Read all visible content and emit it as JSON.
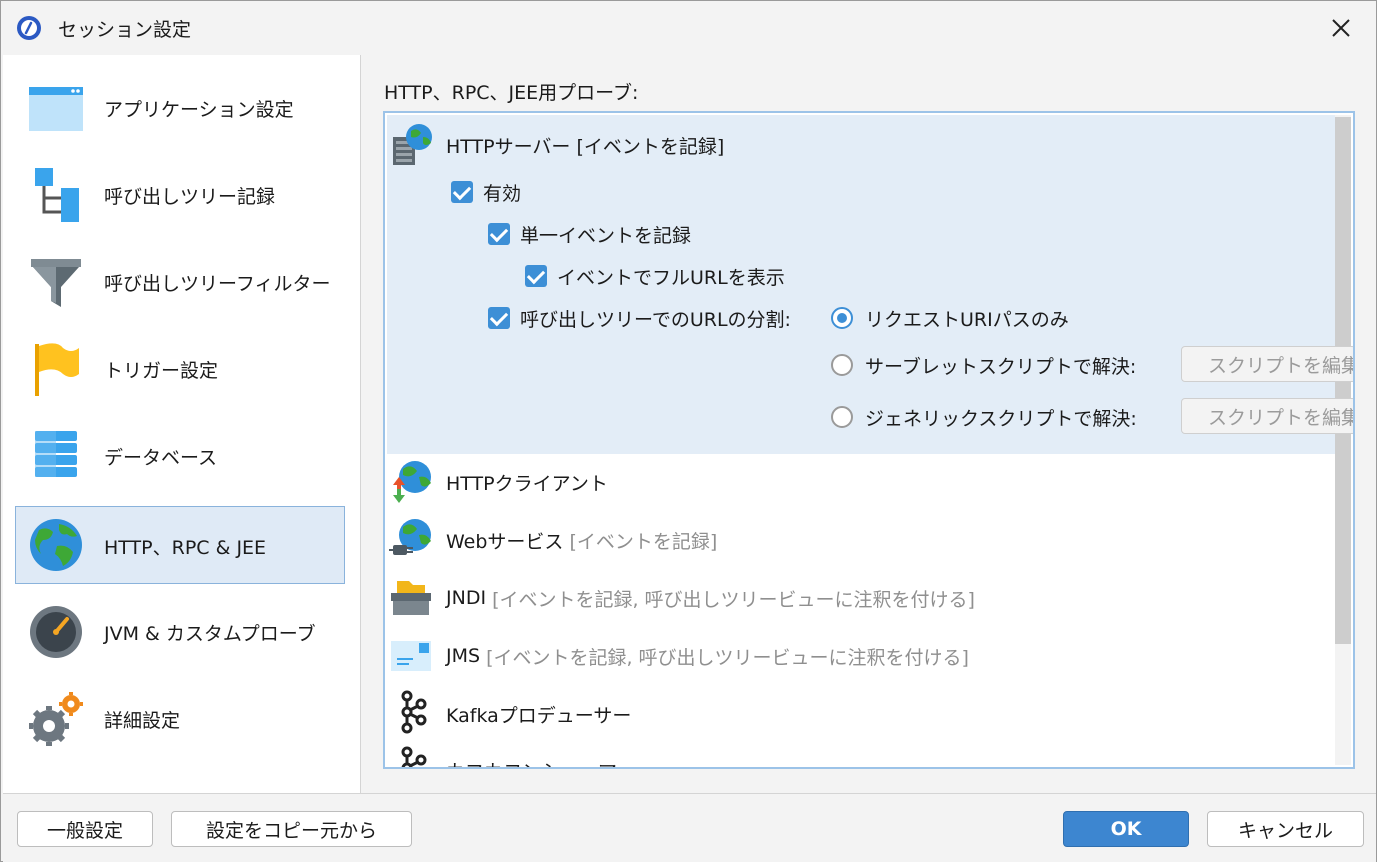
{
  "window": {
    "title": "セッション設定",
    "close_label": "✕"
  },
  "sidebar": {
    "items": [
      {
        "label": "アプリケーション設定",
        "icon": "application-window-icon"
      },
      {
        "label": "呼び出しツリー記録",
        "icon": "tree-hierarchy-icon"
      },
      {
        "label": "呼び出しツリーフィルター",
        "icon": "funnel-filter-icon"
      },
      {
        "label": "トリガー設定",
        "icon": "flag-icon"
      },
      {
        "label": "データベース",
        "icon": "database-icon"
      },
      {
        "label": "HTTP、RPC & JEE",
        "icon": "globe-icon",
        "selected": true
      },
      {
        "label": "JVM & カスタムプローブ",
        "icon": "gauge-icon"
      },
      {
        "label": "詳細設定",
        "icon": "gears-icon"
      }
    ]
  },
  "main": {
    "section_title": "HTTP、RPC、JEE用プローブ:",
    "probes": [
      {
        "name": "HTTPサーバー [イベントを記録]",
        "suffix": "",
        "icon": "server-globe-icon"
      },
      {
        "name": "HTTPクライアント",
        "suffix": "",
        "icon": "globe-arrows-icon"
      },
      {
        "name": "Webサービス",
        "suffix": "[イベントを記録]",
        "icon": "globe-plug-icon"
      },
      {
        "name": "JNDI",
        "suffix": "[イベントを記録, 呼び出しツリービューに注釈を付ける]",
        "icon": "folder-box-icon"
      },
      {
        "name": "JMS",
        "suffix": "[イベントを記録, 呼び出しツリービューに注釈を付ける]",
        "icon": "message-envelope-icon"
      },
      {
        "name": "Kafkaプロデューサー",
        "suffix": "",
        "icon": "kafka-icon"
      },
      {
        "name": "カフカコンシューマー",
        "suffix": "",
        "icon": "kafka-icon"
      }
    ],
    "http_server": {
      "enabled_label": "有効",
      "single_event_label": "単一イベントを記録",
      "full_url_label": "イベントでフルURLを表示",
      "split_label": "呼び出しツリーでのURLの分割:",
      "radio_request_uri": "リクエストURIパスのみ",
      "radio_servlet": "サーブレットスクリプトで解決:",
      "radio_generic": "ジェネリックスクリプトで解決:",
      "script_button": "スクリプトを編集",
      "enabled": true,
      "single_event": true,
      "full_url": true,
      "split": true,
      "selected_radio": "request_uri"
    }
  },
  "footer": {
    "general_settings": "一般設定",
    "copy_settings": "設定をコピー元から",
    "ok": "OK",
    "cancel": "キャンセル"
  },
  "colors": {
    "accent": "#3d8fd6",
    "selection_bg": "#dfeaf6",
    "group_bg": "#e3edf7"
  }
}
